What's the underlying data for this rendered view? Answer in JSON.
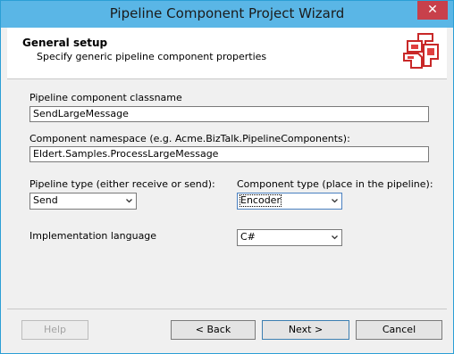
{
  "window": {
    "title": "Pipeline Component Project Wizard",
    "close_glyph": "✕"
  },
  "header": {
    "title": "General setup",
    "subtitle": "Specify generic pipeline component properties",
    "logo_icon": "pipeline-wizard-logo-icon"
  },
  "form": {
    "classname_label": "Pipeline component classname",
    "classname_value": "SendLargeMessage",
    "namespace_label": "Component namespace (e.g. Acme.BizTalk.PipelineComponents):",
    "namespace_value": "Eldert.Samples.ProcessLargeMessage",
    "pipeline_type_label": "Pipeline type (either receive or send):",
    "pipeline_type_value": "Send",
    "component_type_label": "Component type (place in the pipeline):",
    "component_type_value": "Encoder",
    "language_label": "Implementation language",
    "language_value": "C#"
  },
  "buttons": {
    "help": "Help",
    "back": "< Back",
    "next": "Next >",
    "cancel": "Cancel"
  },
  "colors": {
    "titlebar": "#5ab6e6",
    "border": "#2b9fd6",
    "close": "#c8404b",
    "dialog_bg": "#f0f0f0"
  }
}
